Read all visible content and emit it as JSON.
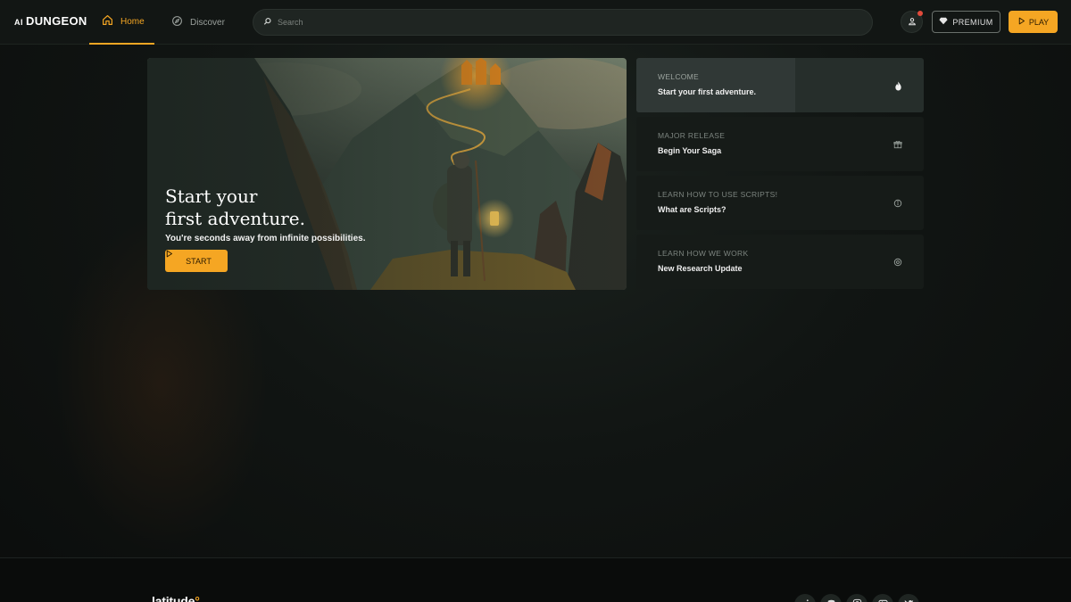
{
  "app": {
    "logo_prefix": "AI",
    "logo_name": "DUNGEON"
  },
  "nav": {
    "home_label": "Home",
    "discover_label": "Discover"
  },
  "search": {
    "placeholder": "Search"
  },
  "header_buttons": {
    "premium_label": "PREMIUM",
    "play_label": "PLAY"
  },
  "hero": {
    "title_line1": "Start your",
    "title_line2": "first adventure.",
    "subtitle": "You're seconds away from infinite possibilities.",
    "start_label": "START"
  },
  "cards": [
    {
      "kicker": "WELCOME",
      "title": "Start your first adventure.",
      "icon": "flame-icon",
      "active": true
    },
    {
      "kicker": "MAJOR RELEASE",
      "title": "Begin Your Saga",
      "icon": "gift-icon",
      "active": false
    },
    {
      "kicker": "LEARN HOW TO USE SCRIPTS!",
      "title": "What are Scripts?",
      "icon": "info-icon",
      "active": false
    },
    {
      "kicker": "LEARN HOW WE WORK",
      "title": "New Research Update",
      "icon": "gear-icon",
      "active": false
    }
  ],
  "footer": {
    "brand": "latitude",
    "socials": [
      "reddit-icon",
      "discord-icon",
      "instagram-icon",
      "youtube-icon",
      "twitter-icon"
    ]
  },
  "colors": {
    "accent": "#f5a623",
    "background": "#111513",
    "notification": "#e24a3b"
  }
}
